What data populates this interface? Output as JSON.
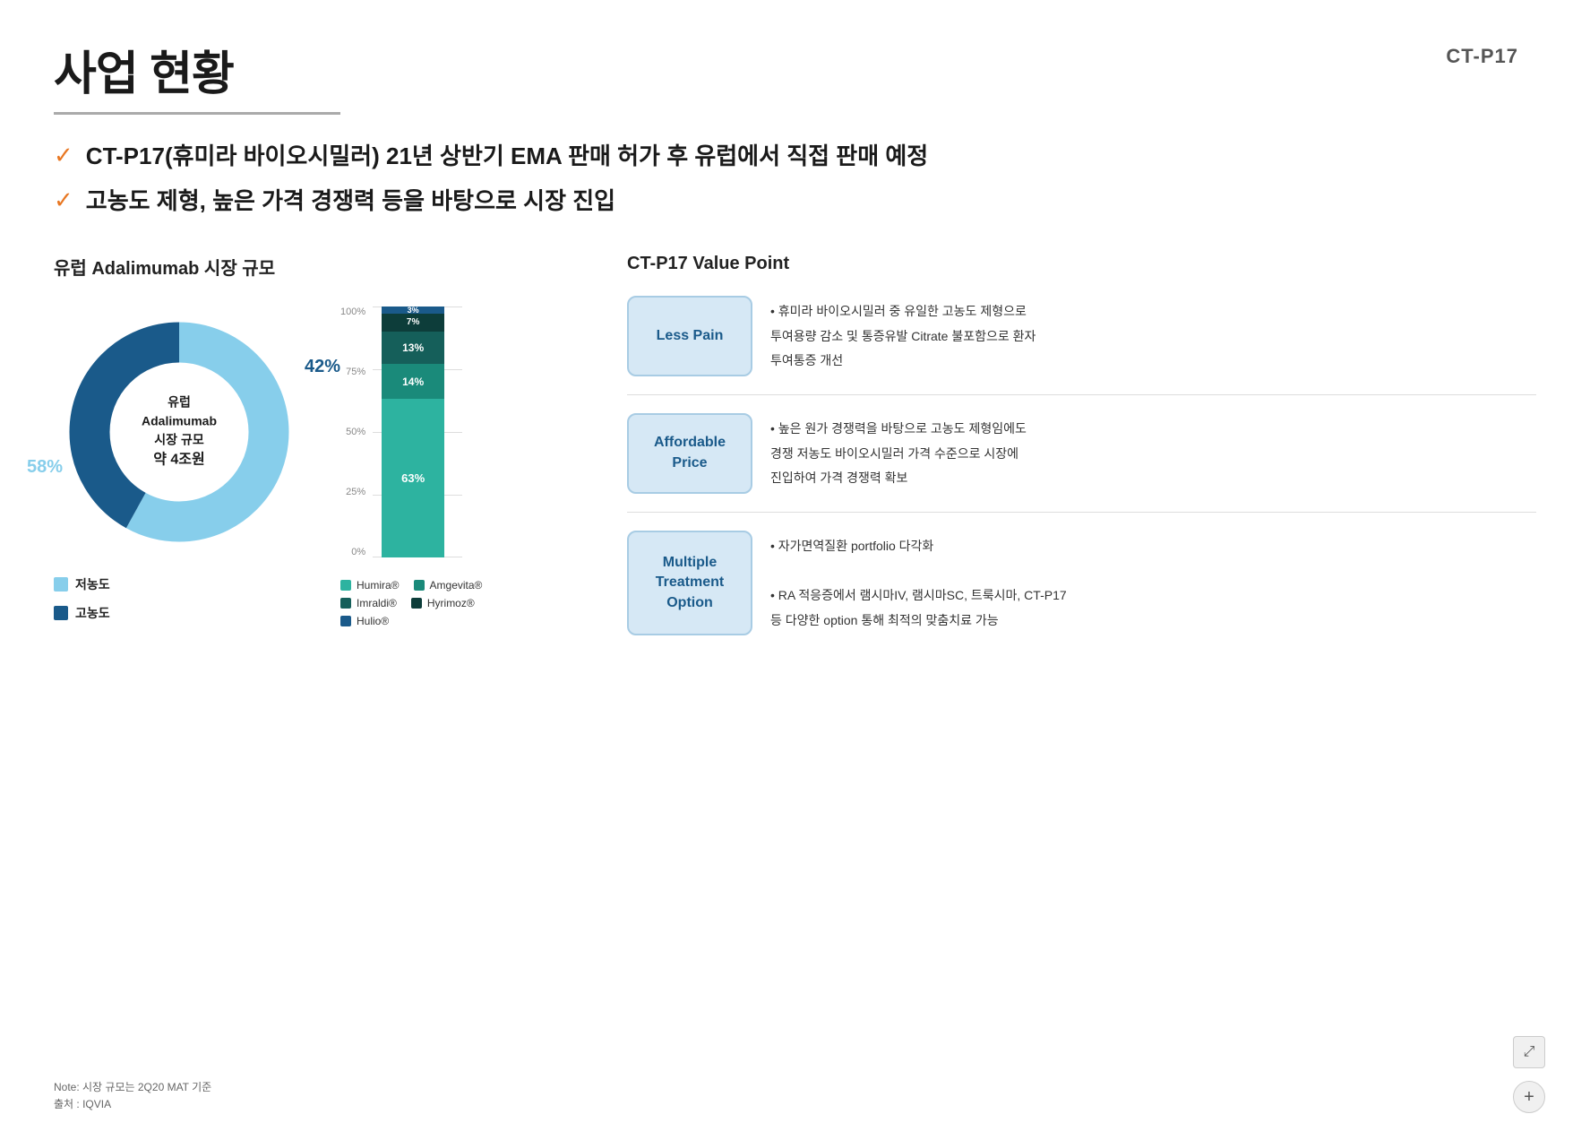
{
  "page": {
    "title": "사업 현황",
    "ct_label": "CT-P17"
  },
  "bullets": [
    {
      "text": "CT-P17(휴미라 바이오시밀러) 21년 상반기 EMA 판매 허가 후 유럽에서 직접 판매 예정"
    },
    {
      "text": "고농도 제형, 높은 가격 경쟁력 등을 바탕으로 시장 진입"
    }
  ],
  "left_section": {
    "title": "유럽 Adalimumab 시장 규모",
    "donut": {
      "center_line1": "유럽",
      "center_line2": "Adalimumab",
      "center_line3": "시장 규모",
      "center_line4": "약 4조원",
      "pct_light": "58%",
      "pct_dark": "42%"
    },
    "legend": [
      {
        "label": "저농도",
        "color": "#87ceeb"
      },
      {
        "label": "고농도",
        "color": "#1a5a8a"
      }
    ],
    "bar": {
      "segments": [
        {
          "label": "63%",
          "color": "#2db3a0",
          "height_pct": 63
        },
        {
          "label": "14%",
          "color": "#1a8a7a",
          "height_pct": 14
        },
        {
          "label": "13%",
          "color": "#155f5a",
          "height_pct": 13
        },
        {
          "label": "7%",
          "color": "#0d3d3a",
          "height_pct": 7
        },
        {
          "label": "3%",
          "color": "#1a5a8a",
          "height_pct": 3
        }
      ],
      "y_labels": [
        "100%",
        "75%",
        "50%",
        "25%",
        "0%"
      ]
    },
    "bar_legend": [
      {
        "label": "Humira®",
        "color": "#2db3a0"
      },
      {
        "label": "Amgevita®",
        "color": "#1a8a7a"
      },
      {
        "label": "Imraldi®",
        "color": "#155f5a"
      },
      {
        "label": "Hyrimoz®",
        "color": "#0d3d3a"
      },
      {
        "label": "Hulio®",
        "color": "#1a5a8a"
      }
    ]
  },
  "right_section": {
    "title": "CT-P17 Value Point",
    "cards": [
      {
        "label": "Less Pain",
        "content_lines": [
          "• 휴미라 바이오시밀러 중 유일한 고농도 제형으로",
          "투여용량 감소 및 통증유발 Citrate 불포함으로 환자",
          "투여통증 개선"
        ]
      },
      {
        "label": "Affordable\nPrice",
        "content_lines": [
          "• 높은 원가 경쟁력을 바탕으로 고농도 제형임에도",
          "경쟁 저농도 바이오시밀러 가격 수준으로 시장에",
          "진입하여 가격 경쟁력 확보"
        ]
      },
      {
        "label": "Multiple\nTreatment\nOption",
        "content_lines": [
          "• 자가면역질환 portfolio 다각화",
          "",
          "• RA 적응증에서 램시마IV, 램시마SC, 트룩시마, CT-P17",
          "등 다양한 option 통해 최적의 맞춤치료 가능"
        ]
      }
    ]
  },
  "footer": {
    "note1": "Note: 시장 규모는 2Q20 MAT 기준",
    "note2": "출처 : IQVIA"
  },
  "icons": {
    "expand": "⤢",
    "plus": "+"
  }
}
